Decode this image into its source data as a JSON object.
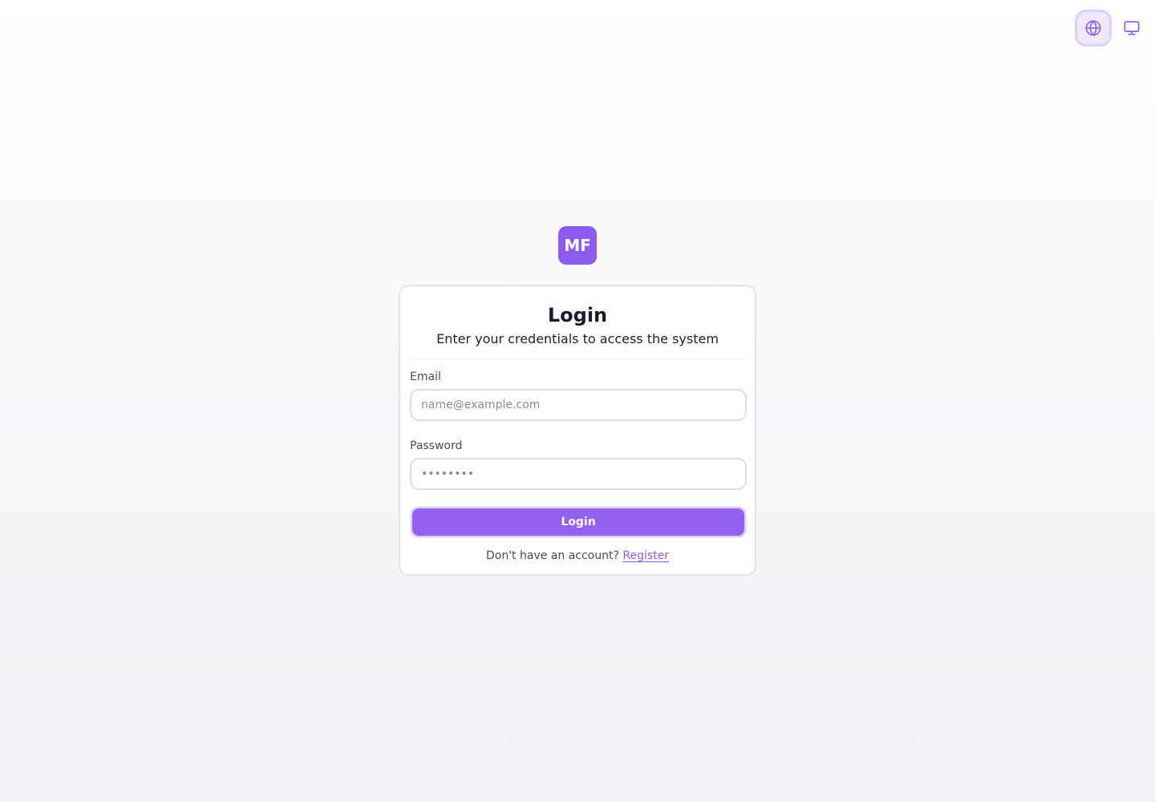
{
  "app": {
    "logo_text": "MF",
    "brand_color": "#8d5bef"
  },
  "top_controls": {
    "language_icon": "globe-icon",
    "display_icon": "monitor-icon"
  },
  "login_card": {
    "title": "Login",
    "subtitle": "Enter your credentials to access the system",
    "email": {
      "label": "Email",
      "placeholder": "name@example.com",
      "value": ""
    },
    "password": {
      "label": "Password",
      "placeholder": "••••••••",
      "value": ""
    },
    "submit_label": "Login",
    "register_prompt": "Don't have an account?",
    "register_link": "Register"
  }
}
